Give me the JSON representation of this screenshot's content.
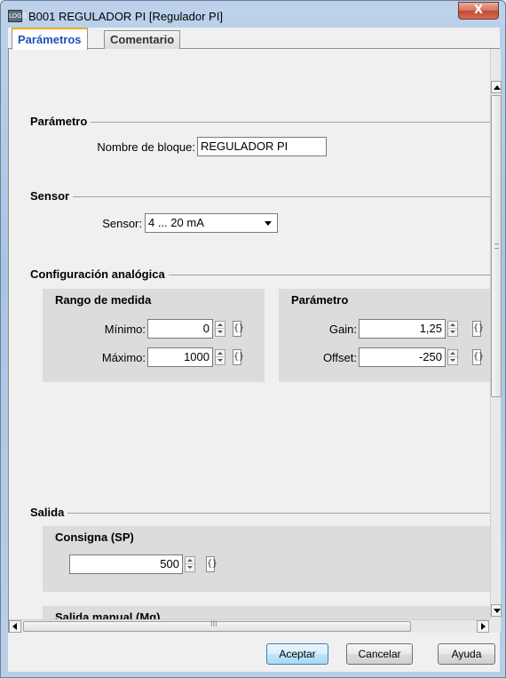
{
  "window": {
    "title": "B001 REGULADOR PI [Regulador PI]",
    "close_label": "X",
    "app_icon_text": "LOGO"
  },
  "tabs": [
    {
      "label": "Parámetros",
      "active": true
    },
    {
      "label": "Comentario",
      "active": false
    }
  ],
  "parametro": {
    "section_title": "Parámetro",
    "block_name_label": "Nombre de bloque:",
    "block_name_value": "REGULADOR PI"
  },
  "sensor": {
    "section_title": "Sensor",
    "label": "Sensor:",
    "selected": "4 ... 20 mA"
  },
  "config_analogica": {
    "section_title": "Configuración analógica",
    "rango": {
      "title": "Rango de medida",
      "min_label": "Mínimo:",
      "min_value": "0",
      "max_label": "Máximo:",
      "max_value": "1000"
    },
    "parametro": {
      "title": "Parámetro",
      "gain_label": "Gain:",
      "gain_value": "1,25",
      "offset_label": "Offset:",
      "offset_value": "-250"
    }
  },
  "salida": {
    "section_title": "Salida",
    "consigna": {
      "title": "Consigna (SP)",
      "value": "500"
    },
    "manual": {
      "title": "Salida manual (Mq)"
    }
  },
  "ref_glyph": "{}",
  "hscroll_grip": "III",
  "buttons": {
    "accept": "Aceptar",
    "cancel": "Cancelar",
    "help": "Ayuda"
  }
}
